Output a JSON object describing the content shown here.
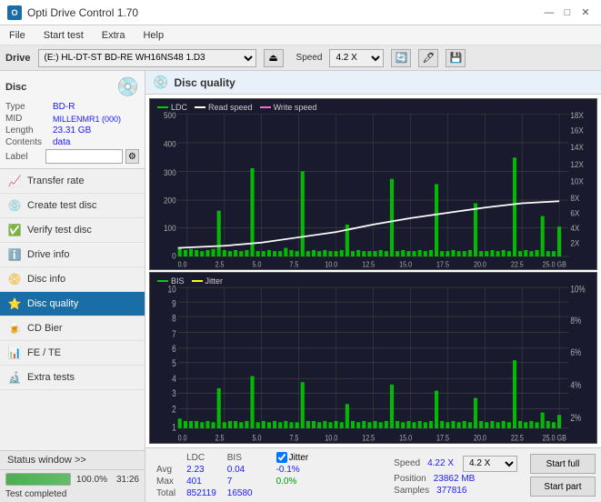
{
  "app": {
    "title": "Opti Drive Control 1.70",
    "title_icon": "O"
  },
  "title_controls": {
    "minimize": "—",
    "maximize": "□",
    "close": "✕"
  },
  "menu": {
    "items": [
      "File",
      "Start test",
      "Extra",
      "Help"
    ]
  },
  "top_bar": {
    "drive_label": "Drive",
    "drive_value": "(E:) HL-DT-ST BD-RE  WH16NS48 1.D3",
    "speed_label": "Speed",
    "speed_value": "4.2 X"
  },
  "disc": {
    "section_label": "Disc",
    "type_label": "Type",
    "type_value": "BD-R",
    "mid_label": "MID",
    "mid_value": "MILLENMR1 (000)",
    "length_label": "Length",
    "length_value": "23.31 GB",
    "contents_label": "Contents",
    "contents_value": "data",
    "label_label": "Label",
    "label_value": ""
  },
  "nav": {
    "items": [
      {
        "id": "transfer-rate",
        "label": "Transfer rate",
        "icon": "📈"
      },
      {
        "id": "create-test-disc",
        "label": "Create test disc",
        "icon": "💿"
      },
      {
        "id": "verify-test-disc",
        "label": "Verify test disc",
        "icon": "✅"
      },
      {
        "id": "drive-info",
        "label": "Drive info",
        "icon": "ℹ️"
      },
      {
        "id": "disc-info",
        "label": "Disc info",
        "icon": "📀"
      },
      {
        "id": "disc-quality",
        "label": "Disc quality",
        "icon": "⭐",
        "active": true
      },
      {
        "id": "cd-bier",
        "label": "CD Bier",
        "icon": "🍺"
      },
      {
        "id": "fe-te",
        "label": "FE / TE",
        "icon": "📊"
      },
      {
        "id": "extra-tests",
        "label": "Extra tests",
        "icon": "🔬"
      }
    ]
  },
  "status": {
    "window_label": "Status window >>",
    "progress_value": 100,
    "progress_text": "100.0%",
    "time": "31:26",
    "completed_text": "Test completed"
  },
  "chart1": {
    "title": "Disc quality",
    "legend": [
      {
        "label": "LDC",
        "color": "#00aa00"
      },
      {
        "label": "Read speed",
        "color": "#ffffff"
      },
      {
        "label": "Write speed",
        "color": "#ff66cc"
      }
    ],
    "y_axis_left": [
      "500",
      "400",
      "300",
      "200",
      "100",
      "0"
    ],
    "y_axis_right": [
      "18X",
      "16X",
      "14X",
      "12X",
      "10X",
      "8X",
      "6X",
      "4X",
      "2X"
    ],
    "x_axis": [
      "0.0",
      "2.5",
      "5.0",
      "7.5",
      "10.0",
      "12.5",
      "15.0",
      "17.5",
      "20.0",
      "22.5",
      "25.0 GB"
    ]
  },
  "chart2": {
    "legend": [
      {
        "label": "BIS",
        "color": "#00aa00"
      },
      {
        "label": "Jitter",
        "color": "#ffff00"
      }
    ],
    "y_axis_left": [
      "10",
      "9",
      "8",
      "7",
      "6",
      "5",
      "4",
      "3",
      "2",
      "1"
    ],
    "y_axis_right": [
      "10%",
      "8%",
      "6%",
      "4%",
      "2%"
    ],
    "x_axis": [
      "0.0",
      "2.5",
      "5.0",
      "7.5",
      "10.0",
      "12.5",
      "15.0",
      "17.5",
      "20.0",
      "22.5",
      "25.0 GB"
    ]
  },
  "stats": {
    "col_ldc": "LDC",
    "col_bis": "BIS",
    "col_jitter": "Jitter",
    "avg_label": "Avg",
    "avg_ldc": "2.23",
    "avg_bis": "0.04",
    "avg_jitter": "-0.1%",
    "max_label": "Max",
    "max_ldc": "401",
    "max_bis": "7",
    "max_jitter": "0.0%",
    "total_label": "Total",
    "total_ldc": "852119",
    "total_bis": "16580",
    "jitter_checked": true,
    "jitter_label": "Jitter",
    "speed_label": "Speed",
    "speed_value": "4.22 X",
    "speed_dropdown": "4.2 X",
    "position_label": "Position",
    "position_value": "23862 MB",
    "samples_label": "Samples",
    "samples_value": "377816",
    "start_full_label": "Start full",
    "start_part_label": "Start part"
  }
}
